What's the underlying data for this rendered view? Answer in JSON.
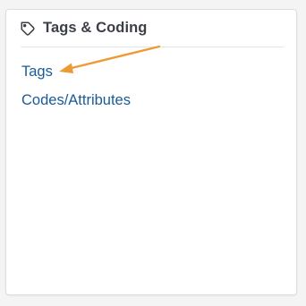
{
  "card": {
    "title": "Tags & Coding",
    "icon": "tag-icon",
    "links": [
      {
        "label": "Tags"
      },
      {
        "label": "Codes/Attributes"
      }
    ]
  },
  "annotation": {
    "type": "arrow",
    "color": "#ee9a33",
    "points_to": "Tags"
  },
  "colors": {
    "link": "#1a5a96",
    "title": "#3b3f47",
    "divider": "#e3e4e7",
    "background": "#f4f4f5",
    "card": "#ffffff"
  }
}
